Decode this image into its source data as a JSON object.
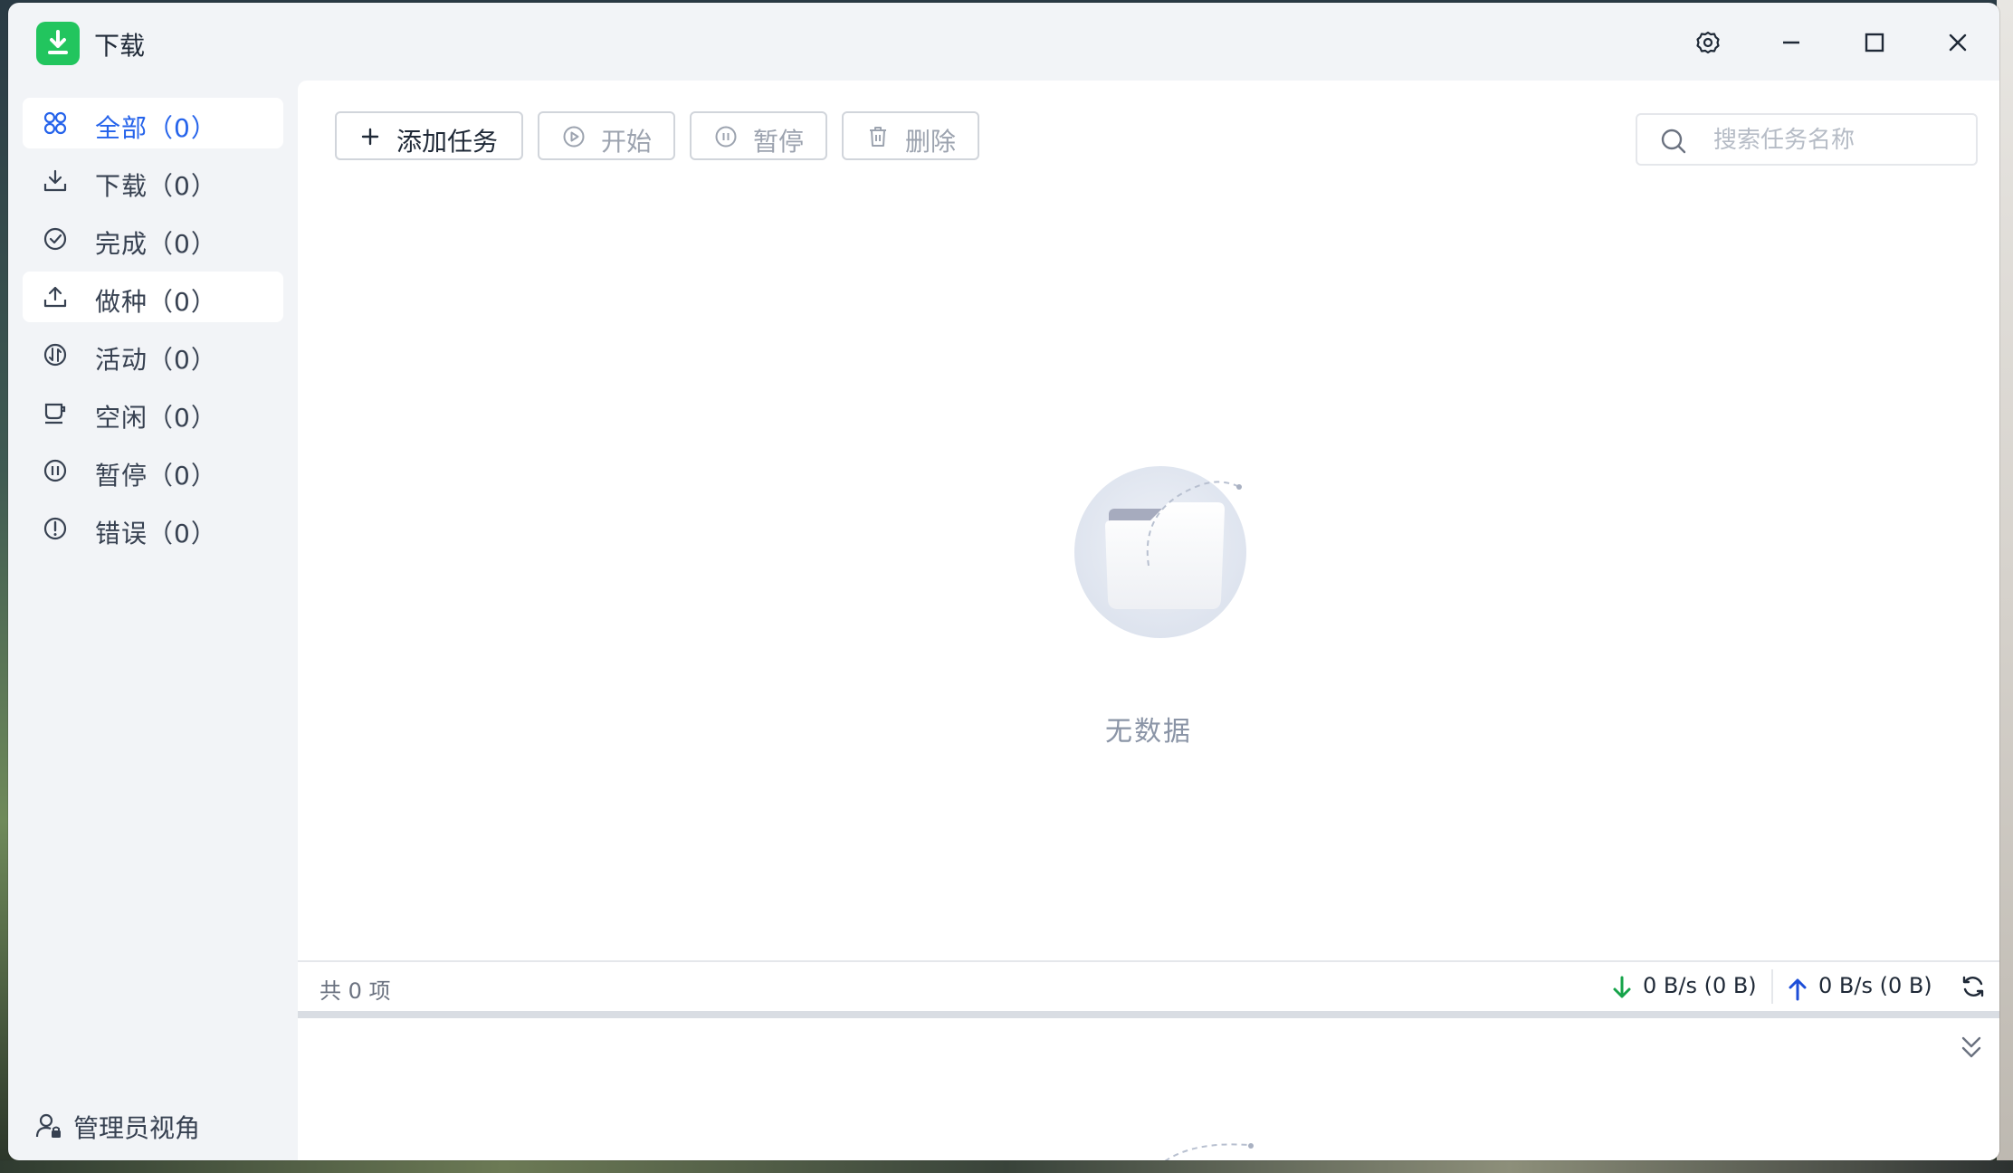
{
  "window": {
    "title": "下载",
    "controls": {
      "settings": "gear-icon",
      "minimize": "minimize-icon",
      "maximize": "maximize-icon",
      "close": "close-icon"
    }
  },
  "sidebar": {
    "items": [
      {
        "label": "全部（0）",
        "icon": "grid-icon",
        "active": true
      },
      {
        "label": "下载（0）",
        "icon": "download-icon"
      },
      {
        "label": "完成（0）",
        "icon": "check-circle-icon"
      },
      {
        "label": "做种（0）",
        "icon": "upload-icon"
      },
      {
        "label": "活动（0）",
        "icon": "activity-icon"
      },
      {
        "label": "空闲（0）",
        "icon": "cup-icon"
      },
      {
        "label": "暂停（0）",
        "icon": "pause-circle-icon"
      },
      {
        "label": "错误（0）",
        "icon": "error-circle-icon"
      }
    ],
    "admin_view": "管理员视角"
  },
  "toolbar": {
    "add_task": "添加任务",
    "start": "开始",
    "pause": "暂停",
    "delete": "删除"
  },
  "search": {
    "placeholder": "搜索任务名称",
    "value": ""
  },
  "empty": {
    "text": "无数据"
  },
  "statusbar": {
    "total": "共 0 项",
    "download_speed": "0 B/s (0 B)",
    "upload_speed": "0 B/s (0 B)"
  },
  "colors": {
    "accent": "#2563eb",
    "brand_green": "#22c55e",
    "download_arrow": "#16a34a",
    "upload_arrow": "#1d4ed8"
  }
}
